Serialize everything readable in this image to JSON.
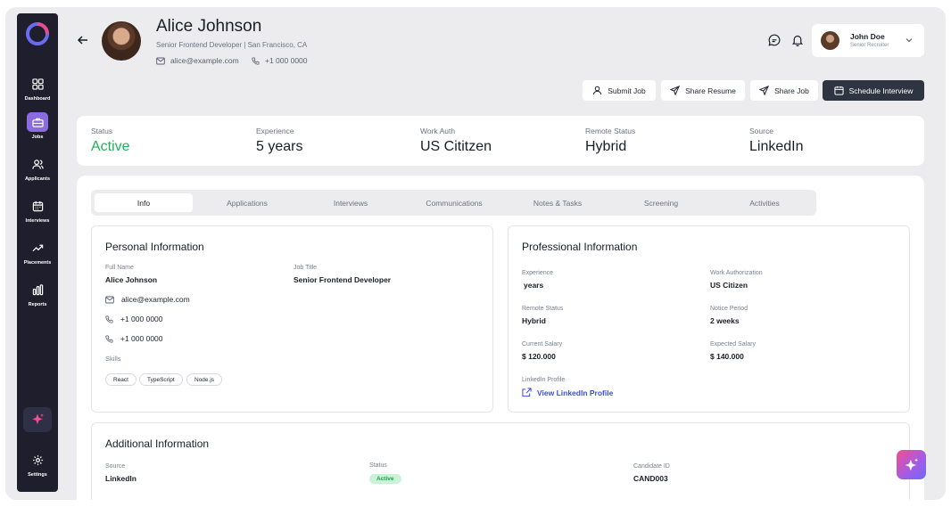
{
  "sidebar": {
    "items": [
      {
        "label": "Dashboard",
        "icon": "grid-icon"
      },
      {
        "label": "Jobs",
        "icon": "briefcase-icon"
      },
      {
        "label": "Applicants",
        "icon": "users-icon"
      },
      {
        "label": "Interviews",
        "icon": "calendar-icon"
      },
      {
        "label": "Placements",
        "icon": "trending-up-icon"
      },
      {
        "label": "Reports",
        "icon": "bar-chart-icon"
      }
    ],
    "settings_label": "Settings",
    "active_index": 1,
    "accent": "#8a6be0"
  },
  "candidate": {
    "name": "Alice Johnson",
    "subtitle": "Senior Frontend Developer | San Francisco, CA",
    "email": "alice@example.com",
    "phone": "+1 000  0000"
  },
  "user": {
    "name": "John Doe",
    "role": "Senior Recruiter"
  },
  "actions": {
    "submit_job": "Submit Job",
    "share_resume": "Share Resume",
    "share_job": "Share Job",
    "schedule_interview": "Schedule Interview"
  },
  "stats": [
    {
      "label": "Status",
      "value": "Active"
    },
    {
      "label": "Experience",
      "value": "5 years"
    },
    {
      "label": "Work Auth",
      "value": "US Cititzen"
    },
    {
      "label": "Remote Status",
      "value": "Hybrid"
    },
    {
      "label": "Source",
      "value": "LinkedIn"
    }
  ],
  "tabs": [
    "Info",
    "Applications",
    "Interviews",
    "Communications",
    "Notes & Tasks",
    "Screening",
    "Activities"
  ],
  "personal": {
    "title": "Personal Information",
    "full_name_label": "Full Name",
    "full_name": "Alice Johnson",
    "job_title_label": "Job Title",
    "job_title": "Senior Frontend Developer",
    "email": "alice@example.com",
    "phone1": "+1 000  0000",
    "phone2": "+1 000  0000",
    "skills_label": "Skills",
    "skills": [
      "React",
      "TypeScript",
      "Node.js"
    ]
  },
  "professional": {
    "title": "Professional Information",
    "experience_label": "Experience",
    "experience": "years",
    "work_auth_label": "Work Authorization",
    "work_auth": "US Citizen",
    "remote_label": "Remote Status",
    "remote": "Hybrid",
    "notice_label": "Notice Period",
    "notice": "2 weeks",
    "current_salary_label": "Current Salary",
    "current_salary": "$ 120.000",
    "expected_salary_label": "Expected Salary",
    "expected_salary": "$ 140.000",
    "linkedin_label": "LinkedIn Profile",
    "linkedin_link": "View LinkedIn Profile"
  },
  "additional": {
    "title": "Additional Information",
    "source_label": "Source",
    "source": "LinkedIn",
    "status_label": "Status",
    "status": "Active",
    "candidate_id_label": "Candidate ID",
    "candidate_id": "CAND003"
  },
  "colors": {
    "status_green": "#22b05a",
    "primary_dark": "#2e3442",
    "link_blue": "#3b4fd8"
  }
}
